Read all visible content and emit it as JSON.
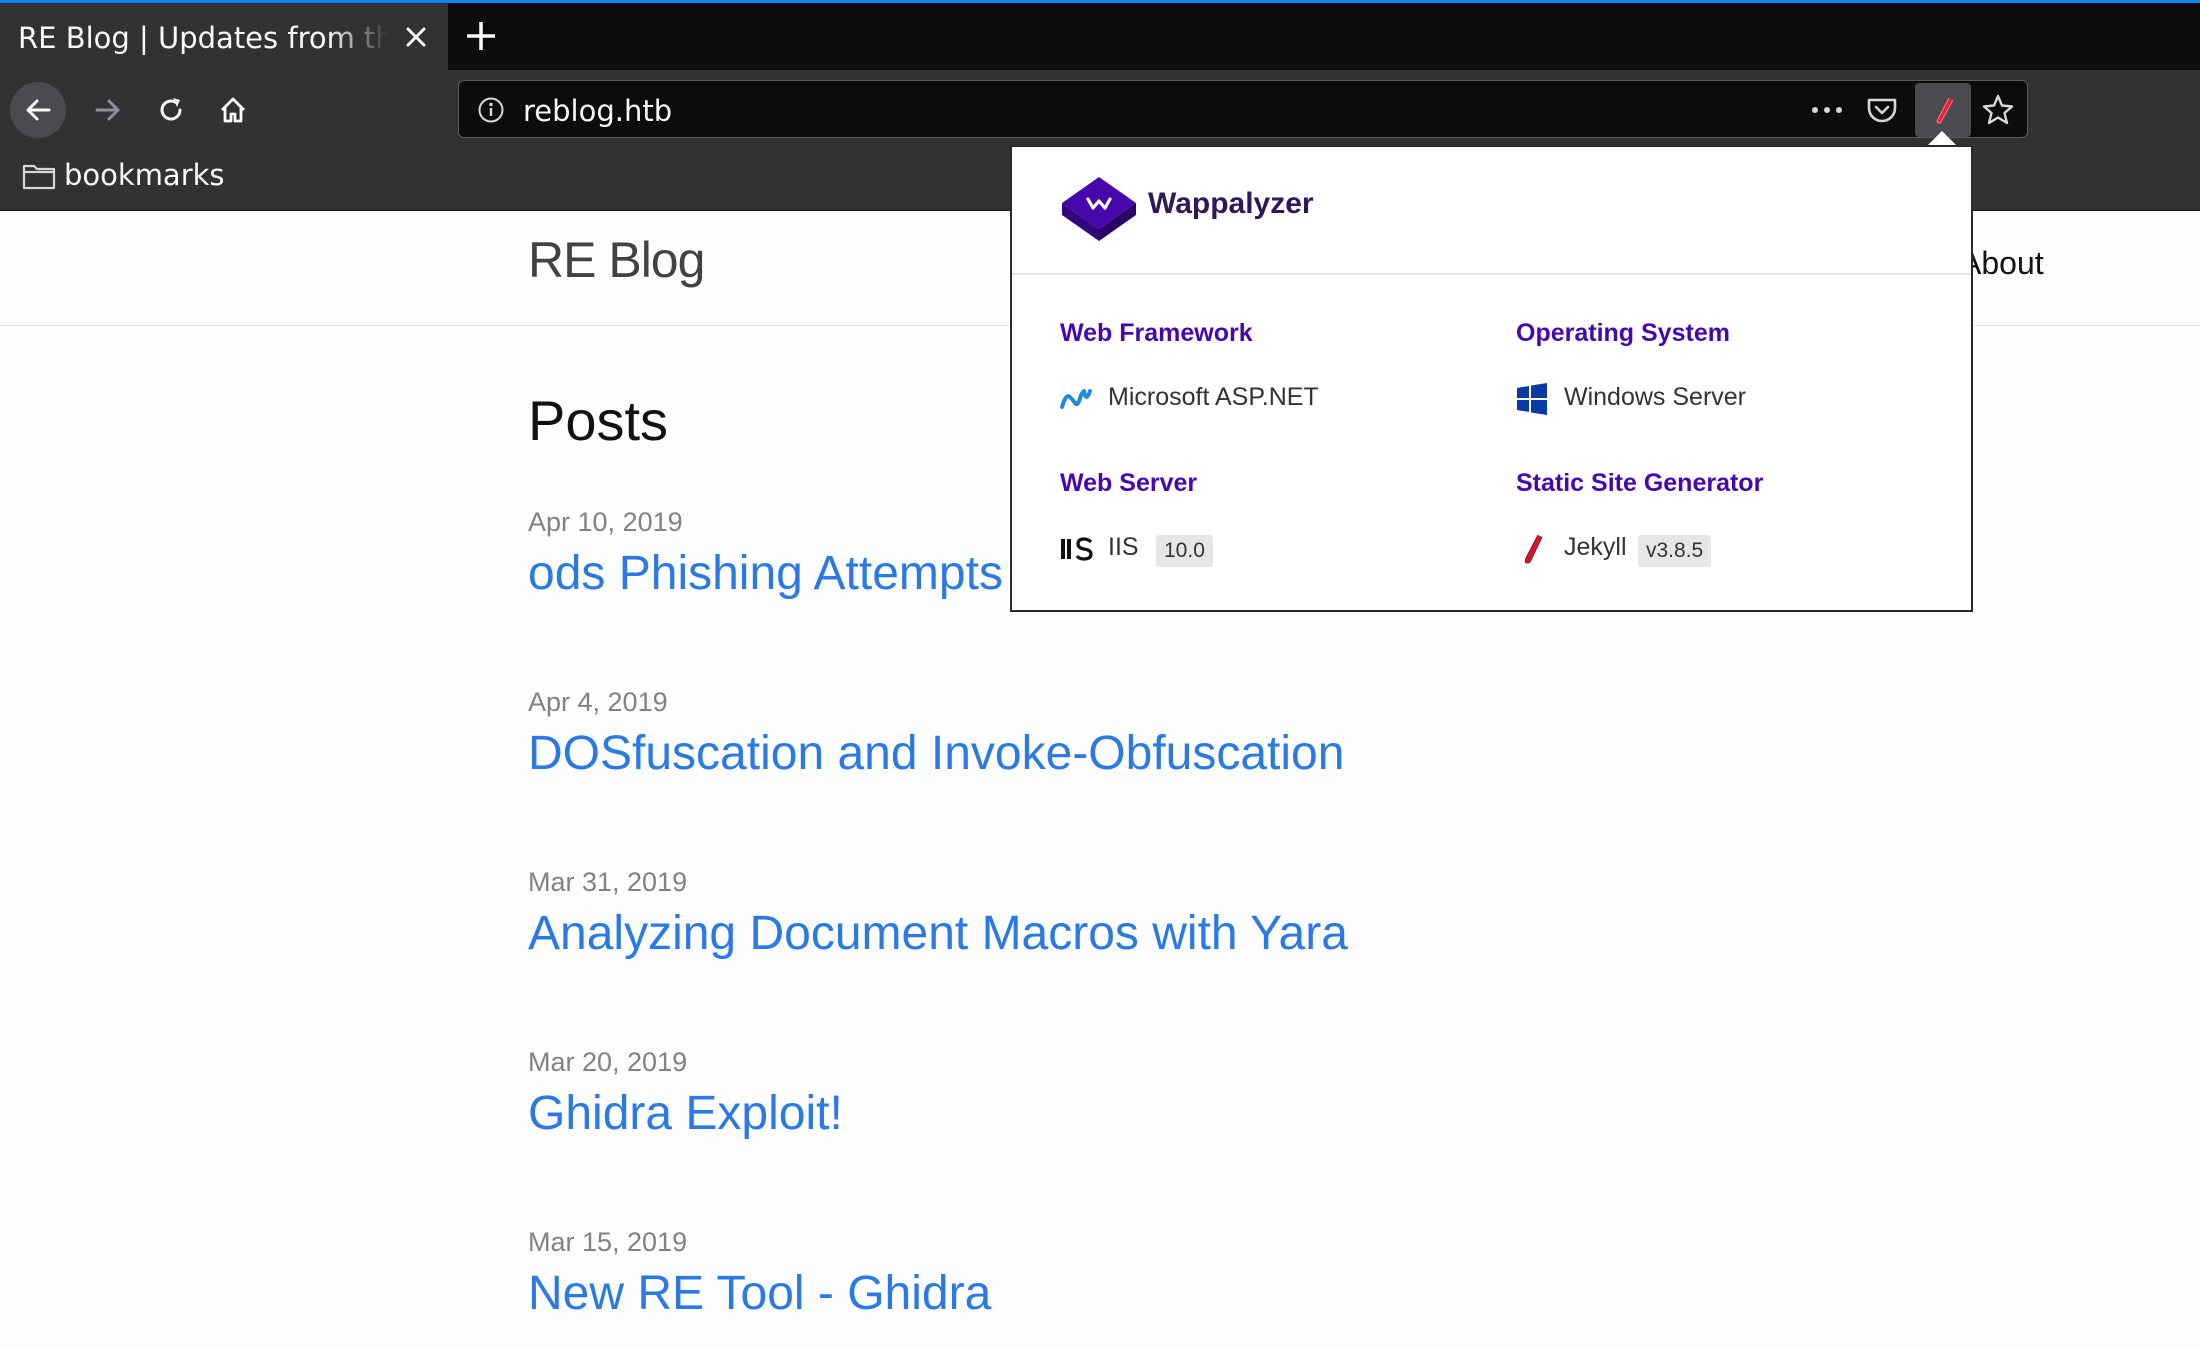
{
  "browser": {
    "tab_title": "RE Blog | Updates from the RE Team",
    "url": "reblog.htb",
    "bookmarks_folder": "bookmarks"
  },
  "site": {
    "title": "RE Blog",
    "nav_about": "About",
    "posts_heading": "Posts",
    "posts": [
      {
        "date": "Apr 10, 2019",
        "title": "ods Phishing Attempts"
      },
      {
        "date": "Apr 4, 2019",
        "title": "DOSfuscation and Invoke-Obfuscation"
      },
      {
        "date": "Mar 31, 2019",
        "title": "Analyzing Document Macros with Yara"
      },
      {
        "date": "Mar 20, 2019",
        "title": "Ghidra Exploit!"
      },
      {
        "date": "Mar 15, 2019",
        "title": "New RE Tool - Ghidra"
      }
    ]
  },
  "wappalyzer": {
    "name": "Wappalyzer",
    "categories": [
      {
        "name": "Web Framework",
        "apps": [
          {
            "name": "Microsoft ASP.NET",
            "version": "",
            "icon": "aspnet-icon"
          }
        ]
      },
      {
        "name": "Operating System",
        "apps": [
          {
            "name": "Windows Server",
            "version": "",
            "icon": "windows-icon"
          }
        ]
      },
      {
        "name": "Web Server",
        "apps": [
          {
            "name": "IIS",
            "version": "10.0",
            "icon": "iis-icon"
          }
        ]
      },
      {
        "name": "Static Site Generator",
        "apps": [
          {
            "name": "Jekyll",
            "version": "v3.8.5",
            "icon": "jekyll-icon"
          }
        ]
      }
    ],
    "colors": {
      "category": "#4608ad",
      "brand": "#4608ad"
    }
  }
}
